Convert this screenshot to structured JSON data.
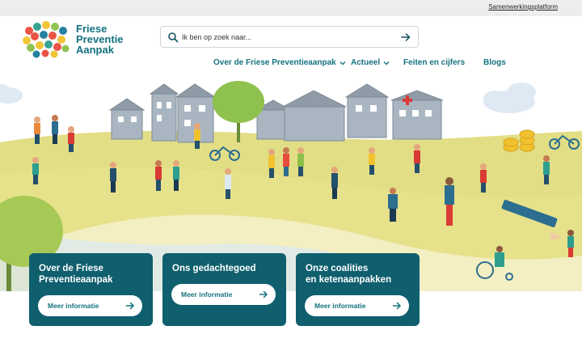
{
  "topbar": {
    "link": "Samenwerkingsplatform"
  },
  "logo": {
    "line1": "Friese",
    "line2": "Preventie",
    "line3": "Aanpak"
  },
  "search": {
    "placeholder": "Ik ben op zoek naar..."
  },
  "nav": {
    "items": [
      {
        "label": "Over de Friese Preventieaanpak",
        "has_dropdown": true
      },
      {
        "label": "Actueel",
        "has_dropdown": true
      },
      {
        "label": "Feiten en cijfers",
        "has_dropdown": false
      },
      {
        "label": "Blogs",
        "has_dropdown": false
      }
    ]
  },
  "cards": [
    {
      "title_line1": "Over de Friese",
      "title_line2": "Preventieaanpak",
      "button": "Meer informatie"
    },
    {
      "title_line1": "Ons gedachtegoed",
      "title_line2": "",
      "button": "Meer informatie"
    },
    {
      "title_line1": "Onze coalities",
      "title_line2": "en ketenaanpakken",
      "button": "Meer informatie"
    }
  ],
  "colors": {
    "brand": "#14727f",
    "card": "#0f5f6e",
    "hill_yellow": "#e3e08a",
    "hill_light": "#f3f0c0",
    "sky": "#ffffff"
  }
}
